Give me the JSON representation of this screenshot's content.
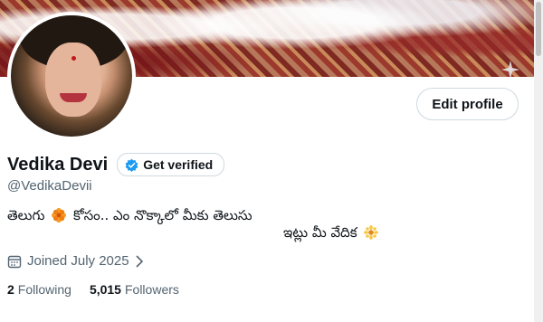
{
  "profile": {
    "name": "Vedika Devi",
    "handle": "@VedikaDevii",
    "verify_label": "Get verified",
    "edit_label": "Edit profile",
    "bio_line1_a": "తెలుగు",
    "bio_line1_b": "కోసం.. ఎం నొక్కాలో మీకు తెలుసు",
    "bio_line2": "ఇట్లు మీ వేదిక",
    "joined": "Joined July 2025",
    "following_count": "2",
    "following_label": "Following",
    "followers_count": "5,015",
    "followers_label": "Followers"
  },
  "icons": {
    "verified": "verified-badge-icon",
    "calendar": "calendar-icon",
    "chevron": "chevron-right-icon",
    "flower": "marigold-flower-icon"
  },
  "colors": {
    "accent": "#1d9bf0",
    "secondary_text": "#536471",
    "border": "#cfd9de"
  }
}
